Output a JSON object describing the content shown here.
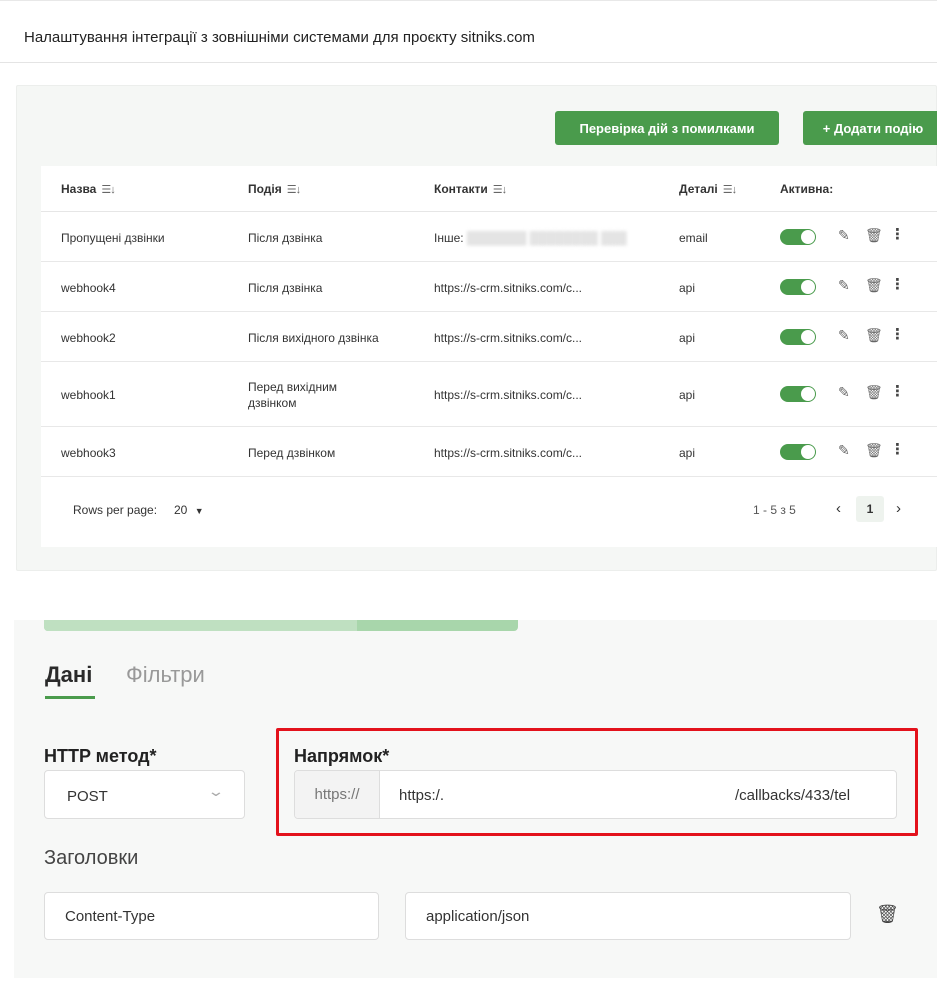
{
  "header": {
    "title": "Налаштування інтеграції з зовнішніми системами для проєкту sitniks.com"
  },
  "toolbar": {
    "check_errors_label": "Перевірка дій з помилками",
    "add_event_label": "+ Додати подію"
  },
  "table": {
    "columns": {
      "name": "Назва",
      "event": "Подія",
      "contacts": "Контакти",
      "details": "Деталі",
      "active": "Активна:"
    },
    "rows": [
      {
        "name": "Пропущені дзвінки",
        "event": "Після дзвінка",
        "contact_prefix": "Інше:",
        "details": "email",
        "active": true
      },
      {
        "name": "webhook4",
        "event": "Після дзвінка",
        "contact": "https://s-crm.sitniks.com/c...",
        "details": "api",
        "active": true
      },
      {
        "name": "webhook2",
        "event": "Після вихідного дзвінка",
        "contact": "https://s-crm.sitniks.com/c...",
        "details": "api",
        "active": true
      },
      {
        "name": "webhook1",
        "event": "Перед вихідним дзвінком",
        "contact": "https://s-crm.sitniks.com/c...",
        "details": "api",
        "active": true
      },
      {
        "name": "webhook3",
        "event": "Перед дзвінком",
        "contact": "https://s-crm.sitniks.com/c...",
        "details": "api",
        "active": true
      }
    ],
    "icons": {
      "edit": "edit-icon",
      "delete": "trash-icon",
      "more": "more-vertical-icon"
    }
  },
  "pagination": {
    "rows_per_page_label": "Rows per page:",
    "rows_per_page_value": "20",
    "range": "1 - 5 з 5",
    "current_page": "1"
  },
  "form": {
    "progress": 0.66,
    "tabs": {
      "data": "Дані",
      "filters": "Фільтри"
    },
    "http_method_label": "HTTP метод*",
    "http_method_value": "POST",
    "direction_label": "Напрямок*",
    "url_prefix": "https://",
    "url_value_start": "https:/.",
    "url_value_end": "/callbacks/433/tel",
    "headers_label": "Заголовки",
    "header_key": "Content-Type",
    "header_value": "application/json"
  },
  "colors": {
    "accent": "#4a9b4c",
    "highlight_frame": "#e3121c"
  }
}
